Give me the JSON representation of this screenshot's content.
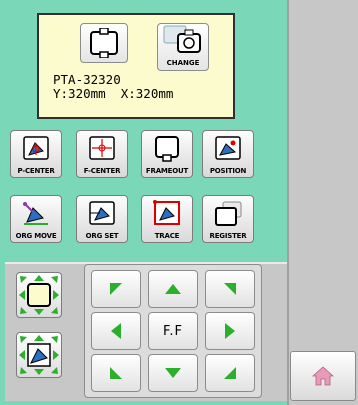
{
  "hoop": {
    "model": "PTA-32320",
    "size_line": "Y:320mm  X:320mm",
    "change_label": "CHANGE"
  },
  "functions": [
    {
      "label": "P-CENTER",
      "icon": "p-center-icon"
    },
    {
      "label": "F-CENTER",
      "icon": "f-center-icon"
    },
    {
      "label": "FRAMEOUT",
      "icon": "frameout-icon"
    },
    {
      "label": "POSITION",
      "icon": "position-icon"
    },
    {
      "label": "ORG MOVE",
      "icon": "org-move-icon"
    },
    {
      "label": "ORG SET",
      "icon": "org-set-icon"
    },
    {
      "label": "TRACE",
      "icon": "trace-icon"
    },
    {
      "label": "REGISTER",
      "icon": "register-icon"
    }
  ],
  "jog": {
    "center_label": "F.F",
    "arrows": [
      "up-left",
      "up",
      "up-right",
      "left",
      "right",
      "down-left",
      "down",
      "down-right"
    ]
  },
  "colors": {
    "background": "#7ad8b8",
    "panel": "#fbfbce",
    "arrow_green": "#2ab02a",
    "home_pink": "#e89ab8"
  }
}
